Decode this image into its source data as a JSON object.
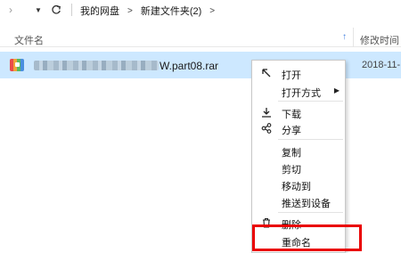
{
  "toolbar": {
    "forward_icon": "chevron-right-icon",
    "dropdown_icon": "caret-down-icon",
    "refresh_icon": "refresh-icon",
    "breadcrumb": [
      "我的网盘",
      "新建文件夹(2)"
    ],
    "separator": ">"
  },
  "columns": {
    "name": "文件名",
    "date": "修改时间",
    "sort_icon": "sort-up-icon"
  },
  "file": {
    "name_suffix": "W.part08.rar",
    "modified": "2018-11-",
    "icon": "archive-rar-icon"
  },
  "menu": {
    "open": "打开",
    "open_with": "打开方式",
    "download": "下载",
    "share": "分享",
    "copy": "复制",
    "cut": "剪切",
    "move_to": "移动到",
    "push_to_device": "推送到设备",
    "delete": "删除",
    "rename": "重命名"
  },
  "colors": {
    "selection": "#cde8ff",
    "highlight": "#ea0000",
    "sort_accent": "#3d7ddf"
  }
}
